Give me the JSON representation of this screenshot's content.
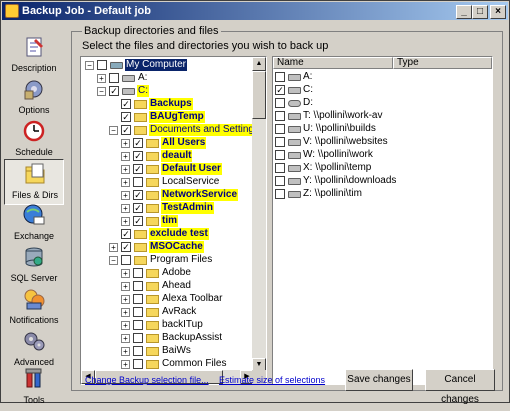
{
  "window": {
    "title": "Backup Job - Default job",
    "min": "_",
    "max": "□",
    "close": "×"
  },
  "sidebar": {
    "items": [
      {
        "label": "Description",
        "icon": "description-icon"
      },
      {
        "label": "Options",
        "icon": "options-icon"
      },
      {
        "label": "Schedule",
        "icon": "schedule-icon"
      },
      {
        "label": "Files & Dirs",
        "icon": "files-dirs-icon"
      },
      {
        "label": "Exchange",
        "icon": "exchange-icon"
      },
      {
        "label": "SQL Server",
        "icon": "sql-server-icon"
      },
      {
        "label": "Notifications",
        "icon": "notifications-icon"
      },
      {
        "label": "Advanced",
        "icon": "advanced-icon"
      },
      {
        "label": "Tools",
        "icon": "tools-icon"
      }
    ]
  },
  "group": {
    "title": "Backup directories and files",
    "subtitle": "Select the files and directories you wish to back up"
  },
  "tree": {
    "rows": [
      {
        "label": "My Computer"
      },
      {
        "label": "A:"
      },
      {
        "label": "C:"
      },
      {
        "label": "Backups"
      },
      {
        "label": "BAUgTemp"
      },
      {
        "label": "Documents and Settings"
      },
      {
        "label": "All Users"
      },
      {
        "label": "deault"
      },
      {
        "label": "Default User"
      },
      {
        "label": "LocalService"
      },
      {
        "label": "NetworkService"
      },
      {
        "label": "TestAdmin"
      },
      {
        "label": "tim"
      },
      {
        "label": "exclude test"
      },
      {
        "label": "MSOCache"
      },
      {
        "label": "Program Files"
      },
      {
        "label": "Adobe"
      },
      {
        "label": "Ahead"
      },
      {
        "label": "Alexa Toolbar"
      },
      {
        "label": "AvRack"
      },
      {
        "label": "backITup"
      },
      {
        "label": "BackupAssist"
      },
      {
        "label": "BaiWs"
      },
      {
        "label": "Common Files"
      }
    ]
  },
  "list": {
    "columns": [
      "Name",
      "Type"
    ],
    "rows": [
      {
        "name": "A:"
      },
      {
        "name": "C:"
      },
      {
        "name": "D:"
      },
      {
        "name": "T: \\\\pollini\\work-av"
      },
      {
        "name": "U: \\\\pollini\\builds"
      },
      {
        "name": "V: \\\\pollini\\websites"
      },
      {
        "name": "W: \\\\pollini\\work"
      },
      {
        "name": "X: \\\\pollini\\temp"
      },
      {
        "name": "Y: \\\\pollini\\downloads"
      },
      {
        "name": "Z: \\\\pollini\\tim"
      }
    ]
  },
  "footer": {
    "change_link": "Change Backup selection file...",
    "estimate_link": "Estimate size of selections",
    "save": "Save changes",
    "cancel": "Cancel changes"
  }
}
